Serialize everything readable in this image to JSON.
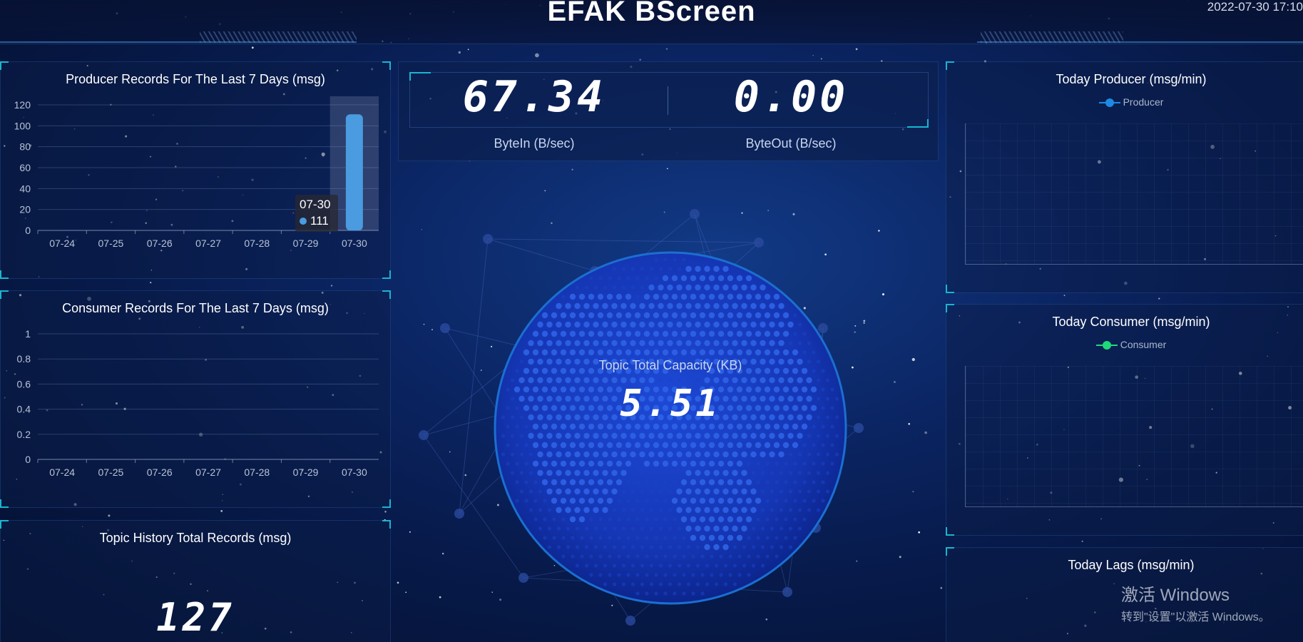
{
  "header": {
    "title": "EFAK BScreen",
    "time": "2022-07-30 17:10"
  },
  "producer_panel": {
    "title": "Producer Records For The Last 7 Days (msg)"
  },
  "consumer_panel": {
    "title": "Consumer Records For The Last 7 Days (msg)"
  },
  "history_panel": {
    "title": "Topic History Total Records (msg)",
    "value": "127"
  },
  "byte_panel": {
    "byte_in": {
      "value": "67.34",
      "label": "ByteIn (B/sec)"
    },
    "byte_out": {
      "value": "0.00",
      "label": "ByteOut (B/sec)"
    }
  },
  "capacity": {
    "label": "Topic Total Capacity (KB)",
    "value": "5.51"
  },
  "today_producer": {
    "title": "Today Producer (msg/min)",
    "legend": "Producer",
    "color": "#1e88e5"
  },
  "today_consumer": {
    "title": "Today Consumer (msg/min)",
    "legend": "Consumer",
    "color": "#1ed97a"
  },
  "today_lags": {
    "title": "Today Lags (msg/min)"
  },
  "tooltip": {
    "date": "07-30",
    "value": "111"
  },
  "watermark": {
    "line1": "激活 Windows",
    "line2": "转到\"设置\"以激活 Windows。"
  },
  "chart_data": [
    {
      "type": "bar",
      "title": "Producer Records For The Last 7 Days (msg)",
      "categories": [
        "07-24",
        "07-25",
        "07-26",
        "07-27",
        "07-28",
        "07-29",
        "07-30"
      ],
      "values": [
        0,
        0,
        0,
        0,
        0,
        0,
        111
      ],
      "yticks": [
        "0",
        "20",
        "40",
        "60",
        "80",
        "100",
        "120"
      ],
      "ylim": [
        0,
        120
      ],
      "color": "#4a9be0"
    },
    {
      "type": "bar",
      "title": "Consumer Records For The Last 7 Days (msg)",
      "categories": [
        "07-24",
        "07-25",
        "07-26",
        "07-27",
        "07-28",
        "07-29",
        "07-30"
      ],
      "values": [
        0,
        0,
        0,
        0,
        0,
        0,
        0
      ],
      "yticks": [
        "0",
        "0.2",
        "0.4",
        "0.6",
        "0.8",
        "1"
      ],
      "ylim": [
        0,
        1
      ],
      "color": "#4a9be0"
    }
  ]
}
